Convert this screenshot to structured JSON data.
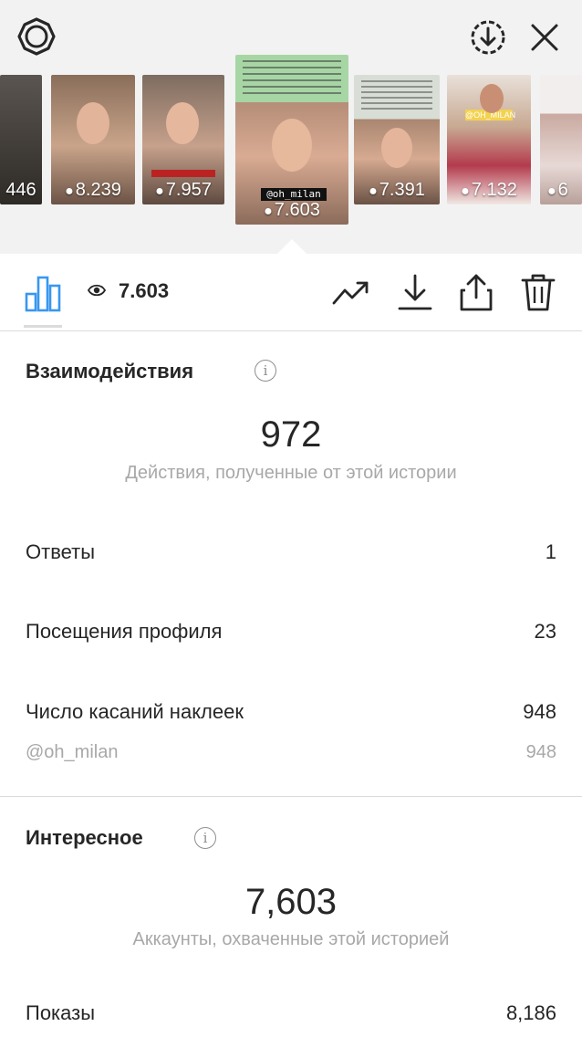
{
  "colors": {
    "accent": "#3897f0",
    "text": "#262626",
    "muted": "#a8a8a8",
    "divider": "#dbdbdb"
  },
  "topbar": {
    "settings_icon": "gear-icon",
    "download_icon": "download-circle-icon",
    "close_icon": "close-icon"
  },
  "thumbnails": [
    {
      "views": "446"
    },
    {
      "views": "8.239"
    },
    {
      "views": "7.957"
    },
    {
      "views": "7.603",
      "handle": "@oh_milan",
      "selected": true
    },
    {
      "views": "7.391"
    },
    {
      "views": "7.132",
      "handle": "@OH_MILAN"
    },
    {
      "views": "6"
    }
  ],
  "toolbar": {
    "insights_icon": "bar-chart-icon",
    "view_count": "7.603",
    "promote_icon": "trend-up-icon",
    "save_icon": "download-icon",
    "share_icon": "share-icon",
    "delete_icon": "trash-icon"
  },
  "interactions": {
    "title": "Взаимодействия",
    "total": "972",
    "total_label": "Действия, полученные от этой истории",
    "rows": [
      {
        "label": "Ответы",
        "value": "1"
      },
      {
        "label": "Посещения профиля",
        "value": "23"
      },
      {
        "label": "Число касаний наклеек",
        "value": "948"
      }
    ],
    "sub_row": {
      "label": "@oh_milan",
      "value": "948"
    }
  },
  "discovery": {
    "title": "Интересное",
    "total": "7,603",
    "total_label": "Аккаунты, охваченные этой историей",
    "rows": [
      {
        "label": "Показы",
        "value": "8,186"
      }
    ]
  }
}
